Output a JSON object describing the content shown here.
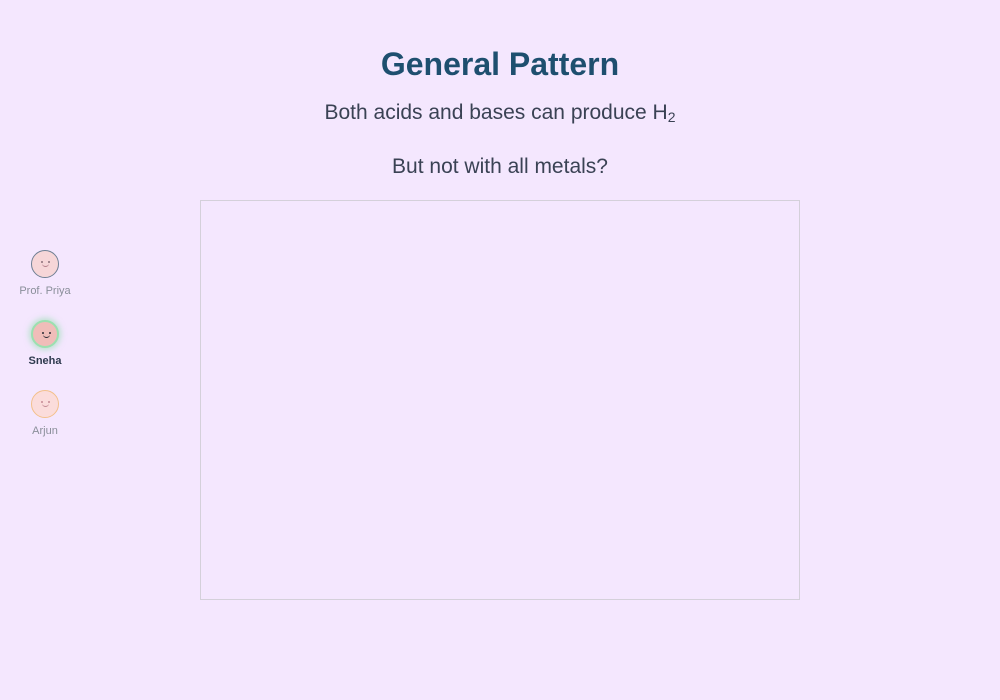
{
  "slide": {
    "title": "General Pattern",
    "subtitle_text": "Both acids and bases can produce H",
    "subtitle_subscript": "2",
    "question": "But not with all metals?"
  },
  "participants": [
    {
      "name": "Prof. Priya",
      "active": false,
      "icon": "smiley-face-icon"
    },
    {
      "name": "Sneha",
      "active": true,
      "icon": "smiley-face-icon"
    },
    {
      "name": "Arjun",
      "active": false,
      "icon": "smiley-face-icon"
    }
  ],
  "colors": {
    "background": "#f4e7fe",
    "title": "#1e4f6f",
    "active_ring": "#9be0b0"
  }
}
